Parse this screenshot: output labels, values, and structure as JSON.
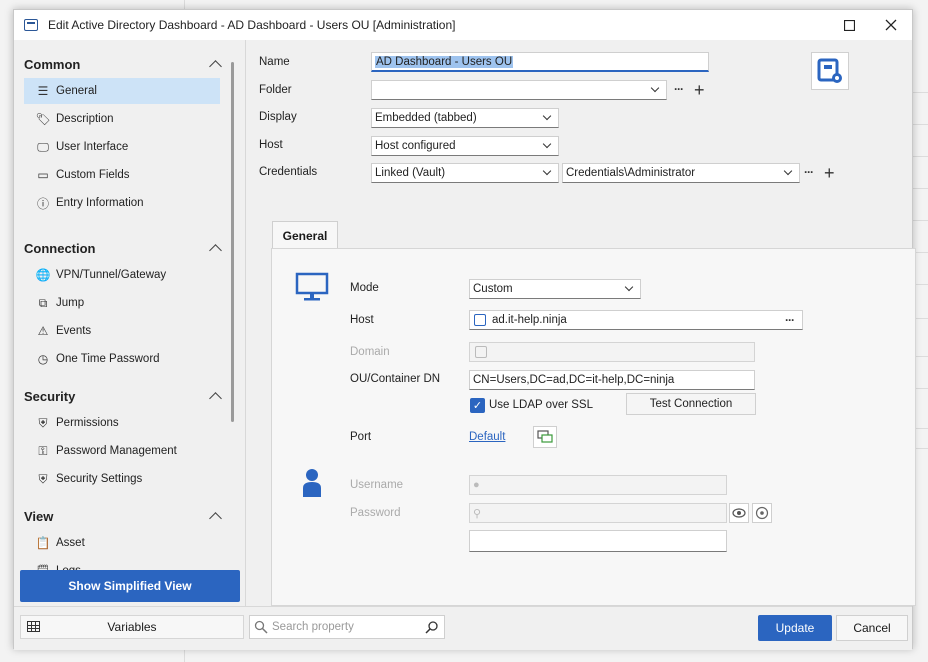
{
  "window": {
    "title": "Edit Active Directory Dashboard - AD Dashboard - Users OU [Administration]"
  },
  "sidebar": {
    "sections": [
      {
        "title": "Common",
        "items": [
          {
            "label": "General",
            "icon": "list-icon"
          },
          {
            "label": "Description",
            "icon": "tag-icon"
          },
          {
            "label": "User Interface",
            "icon": "monitor-icon"
          },
          {
            "label": "Custom Fields",
            "icon": "field-icon"
          },
          {
            "label": "Entry Information",
            "icon": "info-icon"
          }
        ]
      },
      {
        "title": "Connection",
        "items": [
          {
            "label": "VPN/Tunnel/Gateway",
            "icon": "globe-icon"
          },
          {
            "label": "Jump",
            "icon": "jump-icon"
          },
          {
            "label": "Events",
            "icon": "warning-icon"
          },
          {
            "label": "One Time Password",
            "icon": "clock-icon"
          }
        ]
      },
      {
        "title": "Security",
        "items": [
          {
            "label": "Permissions",
            "icon": "shield-icon"
          },
          {
            "label": "Password Management",
            "icon": "key-icon"
          },
          {
            "label": "Security Settings",
            "icon": "shield-gear-icon"
          }
        ]
      },
      {
        "title": "View",
        "items": [
          {
            "label": "Asset",
            "icon": "clipboard-icon"
          },
          {
            "label": "Logs",
            "icon": "logs-icon"
          }
        ]
      }
    ],
    "simplified_view_label": "Show Simplified View"
  },
  "form": {
    "name_label": "Name",
    "name_value": "AD Dashboard - Users OU",
    "folder_label": "Folder",
    "folder_value": "",
    "display_label": "Display",
    "display_value": "Embedded (tabbed)",
    "host_label": "Host",
    "host_value": "Host configured",
    "credentials_label": "Credentials",
    "credentials_mode": "Linked (Vault)",
    "credentials_value": "Credentials\\Administrator"
  },
  "tab": {
    "label": "General",
    "mode_label": "Mode",
    "mode_value": "Custom",
    "host_label": "Host",
    "host_value": "ad.it-help.ninja",
    "domain_label": "Domain",
    "ou_label": "OU/Container DN",
    "ou_value": "CN=Users,DC=ad,DC=it-help,DC=ninja",
    "ldap_ssl_label": "Use LDAP over SSL",
    "test_connection_label": "Test Connection",
    "port_label": "Port",
    "port_value": "Default",
    "username_label": "Username",
    "password_label": "Password"
  },
  "footer": {
    "variables_label": "Variables",
    "search_placeholder": "Search property",
    "update_label": "Update",
    "cancel_label": "Cancel"
  },
  "colors": {
    "accent": "#2b65c0",
    "selection": "#cde3f7"
  }
}
